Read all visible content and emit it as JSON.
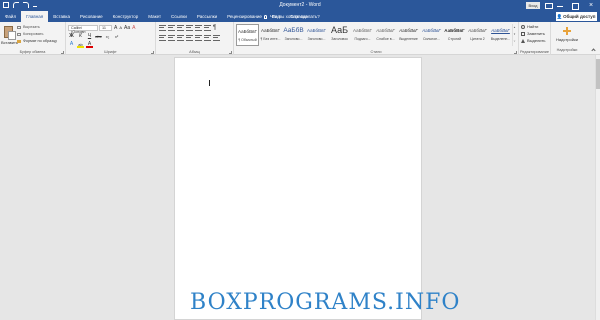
{
  "window": {
    "title": "Документ2 - Word",
    "signin": "Вход",
    "close_glyph": "×"
  },
  "tabs": [
    {
      "label": "Файл",
      "active": false
    },
    {
      "label": "Главная",
      "active": true
    },
    {
      "label": "Вставка",
      "active": false
    },
    {
      "label": "Рисование",
      "active": false
    },
    {
      "label": "Конструктор",
      "active": false
    },
    {
      "label": "Макет",
      "active": false
    },
    {
      "label": "Ссылки",
      "active": false
    },
    {
      "label": "Рассылки",
      "active": false
    },
    {
      "label": "Рецензирование",
      "active": false
    },
    {
      "label": "Вид",
      "active": false
    },
    {
      "label": "Справка",
      "active": false
    }
  ],
  "tell_me": "Что вы хотите сделать?",
  "share": {
    "icon": "person-icon",
    "label": "Общий доступ"
  },
  "clipboard": {
    "paste": "Вставить",
    "cut": "Вырезать",
    "copy": "Копировать",
    "format_painter": "Формат по образцу",
    "label": "Буфер обмена"
  },
  "font": {
    "name": "Calibri (Основн",
    "size": "11",
    "grow": "A",
    "shrink": "A",
    "case": "Aa",
    "clear": "A",
    "bold": "Ж",
    "italic": "К",
    "underline": "Ч",
    "strike": "abc",
    "subscript": "x₂",
    "superscript": "x²",
    "effects": "A",
    "highlight": "ab",
    "color": "A",
    "label": "Шрифт"
  },
  "paragraph": {
    "label": "Абзац",
    "pilcrow": "¶"
  },
  "styles": {
    "label": "Стили",
    "items": [
      {
        "preview": "АаБбВвГ",
        "name": "¶ Обычный",
        "selected": true
      },
      {
        "preview": "АаБбВвГ",
        "name": "¶ Без инте...",
        "selected": false
      },
      {
        "preview": "АаБбВ",
        "name": "Заголово...",
        "selected": false
      },
      {
        "preview": "АаБбВвГ",
        "name": "Заголово...",
        "selected": false
      },
      {
        "preview": "АаБ",
        "name": "Заголовок",
        "selected": false
      },
      {
        "preview": "АаБбВвГ",
        "name": "Подзаго...",
        "selected": false
      },
      {
        "preview": "АаБбВвГ",
        "name": "Слабое в...",
        "selected": false
      },
      {
        "preview": "АаБбВвГ",
        "name": "Выделение",
        "selected": false
      },
      {
        "preview": "АаБбВвГ",
        "name": "Сильное...",
        "selected": false
      },
      {
        "preview": "АаБбВвГ",
        "name": "Строгий",
        "selected": false
      },
      {
        "preview": "АаБбВвГ",
        "name": "Цитата 2",
        "selected": false
      },
      {
        "preview": "АаБбВвГ",
        "name": "Выделенн...",
        "selected": false
      }
    ]
  },
  "editing": {
    "find": "Найти",
    "replace": "Заменить",
    "select": "Выделить",
    "label": "Редактирование"
  },
  "addins": {
    "label": "Надстройки"
  },
  "watermark": "BOXPROGRAMS.INFO"
}
